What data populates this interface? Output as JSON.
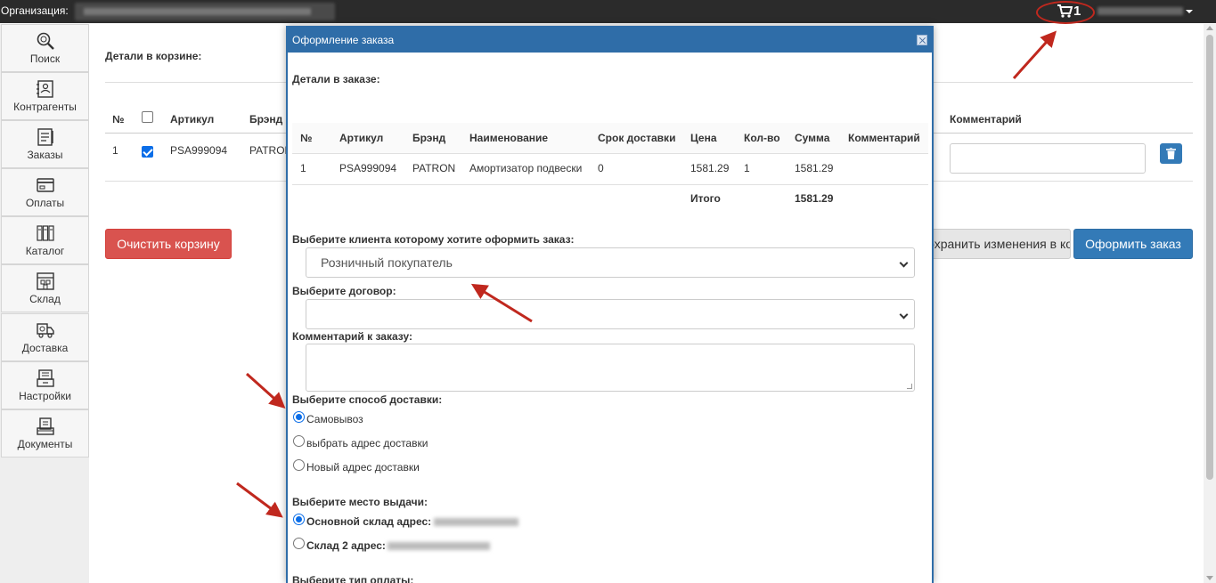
{
  "topbar": {
    "org_label": "Организация:",
    "cart_count": "1"
  },
  "sidebar": {
    "items": [
      {
        "label": "Поиск",
        "icon": "search-icon"
      },
      {
        "label": "Контрагенты",
        "icon": "contacts-icon"
      },
      {
        "label": "Заказы",
        "icon": "orders-icon"
      },
      {
        "label": "Оплаты",
        "icon": "payments-icon"
      },
      {
        "label": "Каталог",
        "icon": "catalog-icon"
      },
      {
        "label": "Склад",
        "icon": "warehouse-icon"
      },
      {
        "label": "Доставка",
        "icon": "delivery-icon"
      },
      {
        "label": "Настройки",
        "icon": "settings-icon"
      },
      {
        "label": "Документы",
        "icon": "documents-icon"
      }
    ]
  },
  "cart": {
    "title": "Детали в корзине:",
    "headers": {
      "num": "№",
      "article": "Артикул",
      "brand": "Брэнд",
      "comment": "Комментарий"
    },
    "row": {
      "num": "1",
      "article": "PSA999094",
      "brand": "PATRON",
      "checked": true
    },
    "clear_button": "Очистить корзину",
    "save_button": "Сохранить изменения в корзине",
    "order_button": "Оформить заказ"
  },
  "modal": {
    "title": "Оформление заказа",
    "details_label": "Детали в заказе:",
    "table": {
      "headers": [
        "№",
        "Артикул",
        "Брэнд",
        "Наименование",
        "Срок доставки",
        "Цена",
        "Кол-во",
        "Сумма",
        "Комментарий"
      ],
      "row": [
        "1",
        "PSA999094",
        "PATRON",
        "Амортизатор подвески",
        "0",
        "1581.29",
        "1",
        "1581.29",
        ""
      ],
      "total_label": "Итого",
      "total_value": "1581.29"
    },
    "client_label": "Выберите клиента которому хотите оформить заказ:",
    "client_value": "Розничный покупатель",
    "contract_label": "Выберите договор:",
    "contract_value": "",
    "comment_label": "Комментарий к заказу:",
    "delivery_label": "Выберите способ доставки:",
    "delivery_options": [
      "Самовывоз",
      "выбрать адрес доставки",
      "Новый адрес доставки"
    ],
    "delivery_selected": 0,
    "pickup_label": "Выберите место выдачи:",
    "pickup_options": [
      "Основной склад адрес:",
      "Склад 2 адрес:"
    ],
    "pickup_selected": 0,
    "payment_label": "Выберите тип оплаты:"
  },
  "colors": {
    "accent": "#337ab7",
    "modal_header": "#2f6da8",
    "danger": "#d9534f",
    "annotation": "#c0281e"
  }
}
